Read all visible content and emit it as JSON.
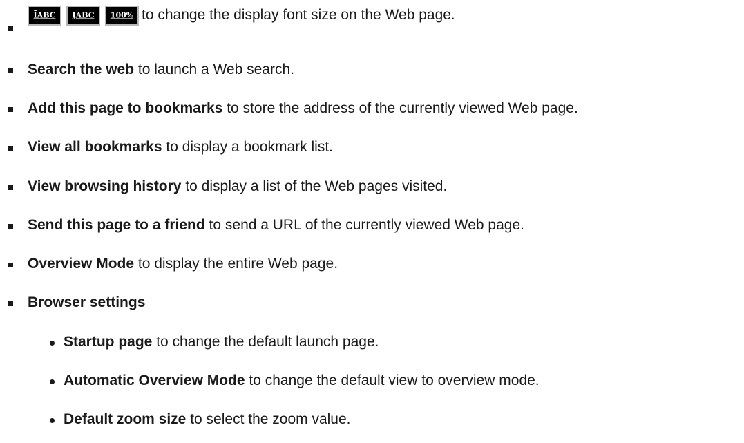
{
  "font_buttons": [
    {
      "label": "ĪABC",
      "icon": "increase-font-icon"
    },
    {
      "label": "ĮABC",
      "icon": "decrease-font-icon"
    },
    {
      "label": "100%",
      "icon": "reset-zoom-icon"
    }
  ],
  "items": [
    {
      "term": "",
      "desc": "to change the display font size on the Web page."
    },
    {
      "term": "Search the web",
      "desc": " to launch a Web search."
    },
    {
      "term": "Add this page to bookmarks",
      "desc": " to store the address of the currently viewed Web page."
    },
    {
      "term": "View all bookmarks",
      "desc": " to display a bookmark list."
    },
    {
      "term": "View browsing history",
      "desc": " to display a list of the Web pages visited."
    },
    {
      "term": "Send this page to a friend",
      "desc": " to send a URL of the currently viewed Web page."
    },
    {
      "term": "Overview Mode",
      "desc": " to display the entire Web page."
    },
    {
      "term": "Browser settings",
      "desc": ""
    }
  ],
  "subitems": [
    {
      "term": "Startup page",
      "desc": " to change the default launch page."
    },
    {
      "term": "Automatic Overview Mode",
      "desc": " to change the default view to overview mode."
    },
    {
      "term": "Default zoom size",
      "desc": " to select the zoom value."
    }
  ]
}
